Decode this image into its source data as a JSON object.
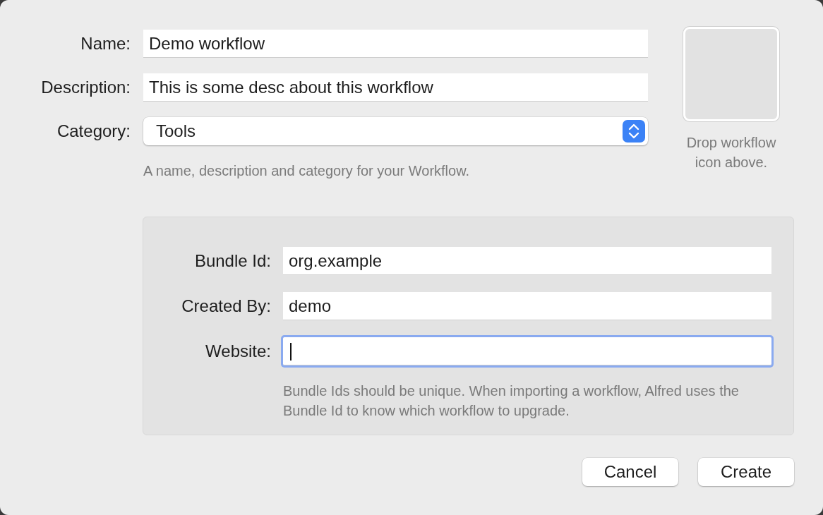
{
  "fields": [
    {
      "label": "Name:",
      "value": "Demo workflow",
      "kind": "text"
    },
    {
      "label": "Description:",
      "value": "This is some desc about this workflow",
      "kind": "text"
    },
    {
      "label": "Category:",
      "value": "Tools",
      "kind": "popup"
    }
  ],
  "fields_hint": "A name, description and category for your Workflow.",
  "icon_well": {
    "caption": "Drop workflow icon above."
  },
  "bundle": {
    "fields": [
      {
        "label": "Bundle Id:",
        "value": "org.example",
        "focused": false
      },
      {
        "label": "Created By:",
        "value": "demo",
        "focused": false
      },
      {
        "label": "Website:",
        "focused": true
      }
    ],
    "hint": "Bundle Ids should be unique. When importing a workflow, Alfred uses the Bundle Id to know which workflow to upgrade."
  },
  "buttons": [
    {
      "label": "Cancel"
    },
    {
      "label": "Create"
    }
  ]
}
